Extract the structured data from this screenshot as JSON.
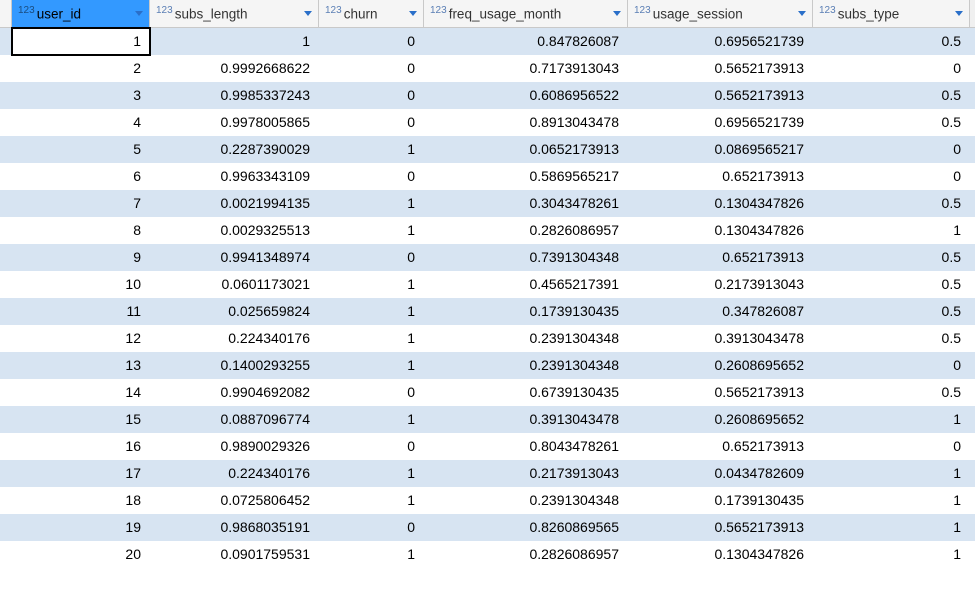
{
  "columns": [
    {
      "type_prefix": "123",
      "name": "user_id",
      "class": "c0",
      "active": true
    },
    {
      "type_prefix": "123",
      "name": "subs_length",
      "class": "c1",
      "active": false
    },
    {
      "type_prefix": "123",
      "name": "churn",
      "class": "c2",
      "active": false
    },
    {
      "type_prefix": "123",
      "name": "freq_usage_month",
      "class": "c3",
      "active": false
    },
    {
      "type_prefix": "123",
      "name": "usage_session",
      "class": "c4",
      "active": false
    },
    {
      "type_prefix": "123",
      "name": "subs_type",
      "class": "c5",
      "active": false
    }
  ],
  "rows": [
    {
      "user_id": "1",
      "subs_length": "1",
      "churn": "0",
      "freq_usage_month": "0.847826087",
      "usage_session": "0.6956521739",
      "subs_type": "0.5"
    },
    {
      "user_id": "2",
      "subs_length": "0.9992668622",
      "churn": "0",
      "freq_usage_month": "0.7173913043",
      "usage_session": "0.5652173913",
      "subs_type": "0"
    },
    {
      "user_id": "3",
      "subs_length": "0.9985337243",
      "churn": "0",
      "freq_usage_month": "0.6086956522",
      "usage_session": "0.5652173913",
      "subs_type": "0.5"
    },
    {
      "user_id": "4",
      "subs_length": "0.9978005865",
      "churn": "0",
      "freq_usage_month": "0.8913043478",
      "usage_session": "0.6956521739",
      "subs_type": "0.5"
    },
    {
      "user_id": "5",
      "subs_length": "0.2287390029",
      "churn": "1",
      "freq_usage_month": "0.0652173913",
      "usage_session": "0.0869565217",
      "subs_type": "0"
    },
    {
      "user_id": "6",
      "subs_length": "0.9963343109",
      "churn": "0",
      "freq_usage_month": "0.5869565217",
      "usage_session": "0.652173913",
      "subs_type": "0"
    },
    {
      "user_id": "7",
      "subs_length": "0.0021994135",
      "churn": "1",
      "freq_usage_month": "0.3043478261",
      "usage_session": "0.1304347826",
      "subs_type": "0.5"
    },
    {
      "user_id": "8",
      "subs_length": "0.0029325513",
      "churn": "1",
      "freq_usage_month": "0.2826086957",
      "usage_session": "0.1304347826",
      "subs_type": "1"
    },
    {
      "user_id": "9",
      "subs_length": "0.9941348974",
      "churn": "0",
      "freq_usage_month": "0.7391304348",
      "usage_session": "0.652173913",
      "subs_type": "0.5"
    },
    {
      "user_id": "10",
      "subs_length": "0.0601173021",
      "churn": "1",
      "freq_usage_month": "0.4565217391",
      "usage_session": "0.2173913043",
      "subs_type": "0.5"
    },
    {
      "user_id": "11",
      "subs_length": "0.025659824",
      "churn": "1",
      "freq_usage_month": "0.1739130435",
      "usage_session": "0.347826087",
      "subs_type": "0.5"
    },
    {
      "user_id": "12",
      "subs_length": "0.224340176",
      "churn": "1",
      "freq_usage_month": "0.2391304348",
      "usage_session": "0.3913043478",
      "subs_type": "0.5"
    },
    {
      "user_id": "13",
      "subs_length": "0.1400293255",
      "churn": "1",
      "freq_usage_month": "0.2391304348",
      "usage_session": "0.2608695652",
      "subs_type": "0"
    },
    {
      "user_id": "14",
      "subs_length": "0.9904692082",
      "churn": "0",
      "freq_usage_month": "0.6739130435",
      "usage_session": "0.5652173913",
      "subs_type": "0.5"
    },
    {
      "user_id": "15",
      "subs_length": "0.0887096774",
      "churn": "1",
      "freq_usage_month": "0.3913043478",
      "usage_session": "0.2608695652",
      "subs_type": "1"
    },
    {
      "user_id": "16",
      "subs_length": "0.9890029326",
      "churn": "0",
      "freq_usage_month": "0.8043478261",
      "usage_session": "0.652173913",
      "subs_type": "0"
    },
    {
      "user_id": "17",
      "subs_length": "0.224340176",
      "churn": "1",
      "freq_usage_month": "0.2173913043",
      "usage_session": "0.0434782609",
      "subs_type": "1"
    },
    {
      "user_id": "18",
      "subs_length": "0.0725806452",
      "churn": "1",
      "freq_usage_month": "0.2391304348",
      "usage_session": "0.1739130435",
      "subs_type": "1"
    },
    {
      "user_id": "19",
      "subs_length": "0.9868035191",
      "churn": "0",
      "freq_usage_month": "0.8260869565",
      "usage_session": "0.5652173913",
      "subs_type": "1"
    },
    {
      "user_id": "20",
      "subs_length": "0.0901759531",
      "churn": "1",
      "freq_usage_month": "0.2826086957",
      "usage_session": "0.1304347826",
      "subs_type": "1"
    }
  ],
  "selected_cell": {
    "row": 0,
    "col": 0
  }
}
